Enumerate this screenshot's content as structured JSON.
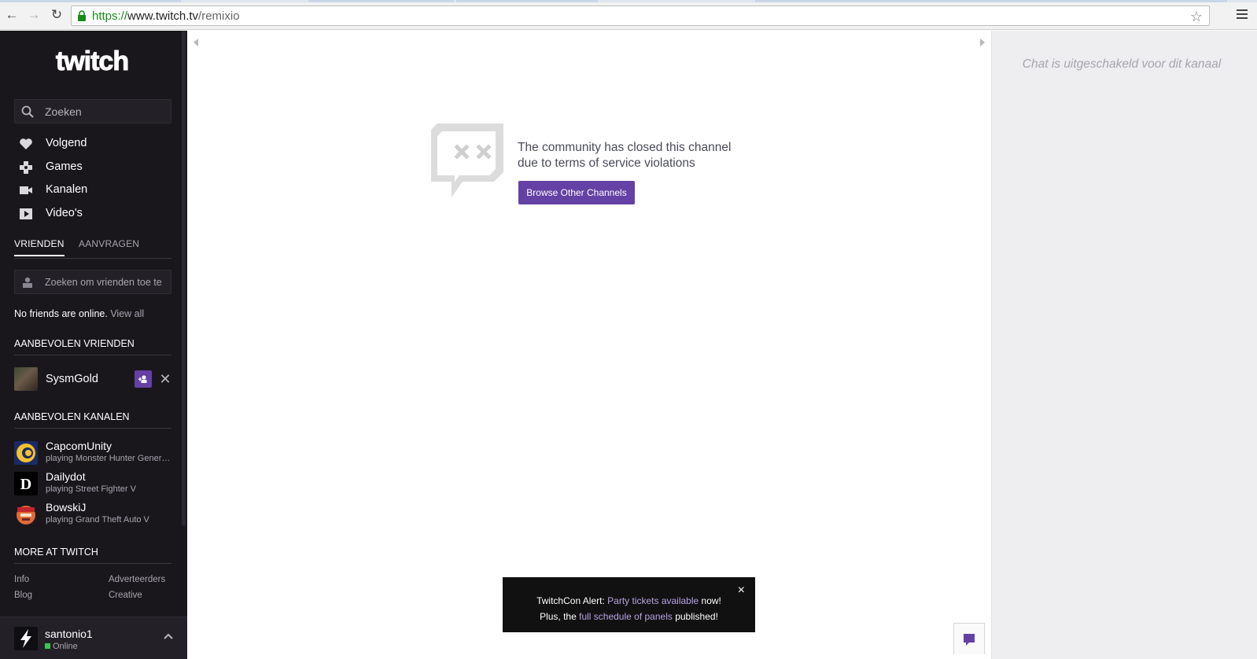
{
  "browser": {
    "url_scheme": "https://",
    "url_host": "www.twitch.tv",
    "url_path": "/remixio"
  },
  "sidebar": {
    "search_placeholder": "Zoeken",
    "nav": [
      {
        "label": "Volgend",
        "icon": "heart-icon"
      },
      {
        "label": "Games",
        "icon": "gamepad-icon"
      },
      {
        "label": "Kanalen",
        "icon": "video-camera-icon"
      },
      {
        "label": "Video's",
        "icon": "play-icon"
      }
    ],
    "tabs": {
      "friends": "VRIENDEN",
      "requests": "AANVRAGEN"
    },
    "friend_search_placeholder": "Zoeken om vrienden toe te voegen",
    "no_friends": "No friends are online.",
    "view_all": "View all",
    "recommended_friends_heading": "AANBEVOLEN VRIENDEN",
    "recommended_friend": {
      "name": "SysmGold"
    },
    "recommended_channels_heading": "AANBEVOLEN KANALEN",
    "channels": [
      {
        "name": "CapcomUnity",
        "game": "playing Monster Hunter Generations"
      },
      {
        "name": "Dailydot",
        "game": "playing Street Fighter V"
      },
      {
        "name": "BowskiJ",
        "game": "playing Grand Theft Auto V"
      }
    ],
    "more_heading": "MORE AT TWITCH",
    "more_links": [
      "Info",
      "Adverteerders",
      "Blog",
      "Creative"
    ],
    "user": {
      "name": "santonio1",
      "status": "Online"
    }
  },
  "main": {
    "closed_line1": "The community has closed this channel",
    "closed_line2": "due to terms of service violations",
    "browse_button": "Browse Other Channels",
    "alert": {
      "prefix1": "TwitchCon Alert: ",
      "link1": "Party tickets available",
      "suffix1": " now!",
      "prefix2": "Plus, the ",
      "link2": "full schedule of panels",
      "suffix2": " published!",
      "close": "×"
    }
  },
  "chat": {
    "disabled_message": "Chat is uitgeschakeld voor dit kanaal"
  },
  "colors": {
    "brand_purple": "#6441a4",
    "sidebar_bg": "#19171c",
    "chat_bg": "#eeeef1",
    "online_green": "#3ec25a"
  }
}
